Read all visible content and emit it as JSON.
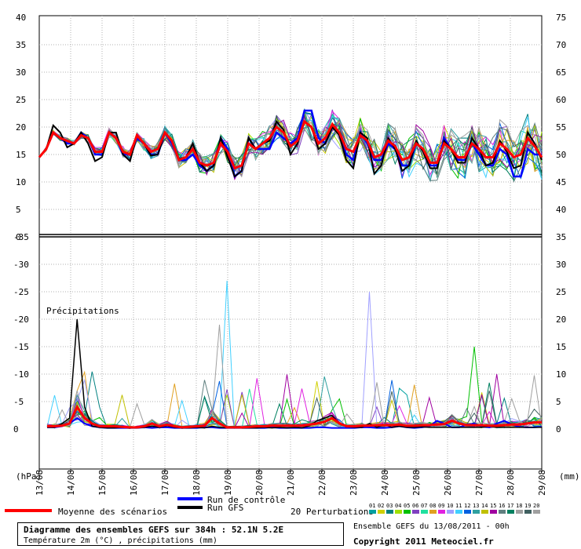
{
  "chart_data": {
    "type": "line",
    "top_panel": {
      "y_left_ticks": [
        40,
        35,
        30,
        25,
        20,
        15,
        10,
        5,
        0
      ],
      "y_right_ticks": [
        75,
        70,
        65,
        60,
        55,
        50,
        45,
        40,
        35
      ],
      "ylim": [
        0,
        40
      ]
    },
    "bottom_panel": {
      "title": "Précipitations",
      "y_left_ticks": [
        0,
        -5,
        -10,
        -15,
        -20,
        -25,
        -30,
        -35
      ],
      "y_right_ticks": [
        35,
        30,
        25,
        20,
        15,
        10,
        5,
        0
      ],
      "ylim": [
        0,
        35
      ]
    },
    "x_dates": [
      "13/08",
      "14/08",
      "15/08",
      "16/08",
      "17/08",
      "18/08",
      "19/08",
      "20/08",
      "21/08",
      "22/08",
      "23/08",
      "24/08",
      "25/08",
      "26/08",
      "27/08",
      "28/08",
      "29/08"
    ],
    "x_left_unit": "(hPa)",
    "x_right_unit": "(mm)",
    "temp_mean": [
      14.5,
      16,
      19,
      18,
      17.5,
      17,
      18.5,
      18,
      15.5,
      15.5,
      19,
      18,
      15.5,
      15,
      18.5,
      17,
      15.5,
      16,
      19,
      17.5,
      14,
      14.5,
      16,
      13.5,
      13,
      13.5,
      17,
      15.5,
      12.5,
      13,
      17,
      16,
      17,
      18,
      20,
      19,
      16.5,
      17.5,
      21,
      20,
      17,
      18,
      20.5,
      19,
      16,
      15.5,
      18.5,
      17.5,
      14.5,
      15,
      17.5,
      16.5,
      14,
      14.5,
      17,
      16,
      13.5,
      13.5,
      17,
      16,
      14.5,
      14.5,
      17,
      16,
      14.5,
      14.5,
      17,
      16,
      14.5,
      15,
      18,
      16.5,
      14.5
    ],
    "temp_gfs": [
      14.5,
      16,
      20.3,
      19,
      16.3,
      17,
      19,
      17,
      13.8,
      14.5,
      19,
      19,
      15,
      13.8,
      18.5,
      17,
      14.8,
      15,
      19,
      17.5,
      14.2,
      14.5,
      17,
      13.5,
      12,
      13,
      18,
      14.5,
      11,
      12,
      18,
      16,
      17,
      17.5,
      21,
      19.5,
      15,
      17,
      21,
      20,
      16,
      17,
      20,
      18.5,
      14,
      12.5,
      19,
      18,
      11.5,
      13,
      18,
      16,
      12,
      13,
      17.5,
      15.5,
      12.5,
      12.5,
      17.5,
      16,
      13.5,
      13.5,
      18,
      16,
      13,
      13.5,
      17.5,
      15.5,
      12.5,
      13,
      19,
      17,
      14
    ],
    "temp_control": [
      14.5,
      16,
      19,
      18,
      17,
      17,
      19,
      18,
      15,
      15,
      19,
      18,
      15,
      15,
      18,
      17,
      15,
      15,
      19,
      17,
      14,
      14,
      15,
      13,
      12,
      13,
      18,
      16,
      11,
      12,
      18,
      16,
      16,
      16,
      19,
      18,
      17,
      18,
      23,
      23,
      18,
      17,
      20,
      19,
      15,
      14,
      19,
      17,
      14,
      14,
      17,
      16,
      13,
      13,
      17,
      16,
      13,
      13,
      18,
      16,
      14,
      14,
      17,
      15,
      13,
      13,
      16,
      15,
      11,
      11,
      16,
      15,
      15
    ],
    "precip_mean": [
      0.5,
      0.5,
      0.6,
      1,
      4,
      2,
      1,
      0.5,
      0.5,
      0.5,
      0.4,
      0.3,
      0.3,
      0.5,
      1,
      0.5,
      0.8,
      0.5,
      0.3,
      0.4,
      0.5,
      0.6,
      2,
      1,
      0.3,
      0.3,
      0.3,
      0.4,
      0.5,
      0.5,
      0.6,
      0.6,
      0.6,
      0.6,
      0.6,
      0.8,
      1,
      1.3,
      2,
      1,
      0.5,
      0.5,
      0.6,
      0.6,
      0.7,
      0.7,
      0.7,
      0.8,
      0.6,
      0.6,
      0.7,
      0.7,
      0.8,
      0.9,
      1.5,
      1,
      0.7,
      0.7,
      0.7,
      0.6,
      0.6,
      0.7,
      0.8,
      0.8,
      1,
      1.2,
      1.2
    ],
    "precip_gfs": [
      0.3,
      0.3,
      1,
      2,
      20,
      4,
      0.5,
      0.3,
      0.2,
      0.2,
      0.3,
      0.2,
      0.2,
      0.3,
      0.5,
      0.3,
      0.6,
      0.3,
      0.2,
      0.2,
      0.3,
      0.2,
      0.5,
      0.3,
      0.2,
      0.2,
      0.2,
      0.2,
      0.2,
      0.3,
      0.2,
      0.3,
      0.2,
      0.3,
      0.2,
      0.6,
      1.5,
      2,
      2.5,
      1,
      0.4,
      0.3,
      0.3,
      1,
      0.3,
      0.8,
      0.3,
      0.5,
      0.3,
      0.3,
      0.4,
      0.3,
      0.3,
      0.3,
      0.3,
      0.3,
      0.3,
      0.3,
      0.3,
      0.5,
      0.3,
      0.3,
      0.3,
      0.3,
      0.3,
      0.3,
      0.3
    ],
    "precip_control": [
      0.3,
      0.3,
      0.5,
      1,
      2,
      1,
      0.5,
      0.3,
      0.2,
      0.2,
      0.2,
      0.2,
      0.2,
      0.3,
      0.2,
      0.3,
      0.3,
      0.2,
      0.2,
      0.2,
      0.2,
      0.3,
      0.3,
      0.2,
      0.2,
      0.2,
      0.2,
      0.2,
      0.2,
      0.2,
      0.3,
      0.2,
      0.2,
      0.2,
      0.2,
      0.2,
      0.3,
      0.3,
      0.2,
      0.2,
      0.2,
      0.2,
      0.3,
      0.3,
      0.2,
      0.2,
      0.3,
      0.5,
      0.3,
      0.2,
      0.3,
      0.5,
      1.5,
      1,
      0.3,
      0.3,
      0.8,
      1,
      0.4,
      0.3,
      1,
      1.5,
      0.8,
      0.4,
      0.3,
      0.3,
      0.4
    ],
    "ensemble_colors": [
      "#00a0a0",
      "#d0d000",
      "#008080",
      "#a0e000",
      "#00c000",
      "#8040c0",
      "#20e0a0",
      "#e0a020",
      "#e020e0",
      "#a0a0ff",
      "#40d0ff",
      "#0060e0",
      "#30a0a0",
      "#c0c000",
      "#a000a0",
      "#608080",
      "#008060",
      "#a0a0a0",
      "#406060",
      "#a0a0a0"
    ],
    "legend": {
      "mean": "Moyenne des scénarios",
      "control": "Run de contrôle",
      "gfs": "Run GFS",
      "perturbations": "20 Perturbations",
      "perturbation_ids": [
        "01",
        "02",
        "03",
        "04",
        "05",
        "06",
        "07",
        "08",
        "09",
        "10",
        "11",
        "12",
        "13",
        "14",
        "15",
        "16",
        "17",
        "18",
        "19",
        "20"
      ]
    },
    "colors": {
      "mean": "#ff0000",
      "control": "#0000ff",
      "gfs": "#000000"
    }
  },
  "footer": {
    "title": "Diagramme des ensembles GEFS sur 384h : 52.1N 5.2E",
    "subtitle": "Température 2m (°C) , précipitations (mm)",
    "run": "Ensemble GEFS du 13/08/2011 - 00h",
    "copyright": "Copyright 2011 Meteociel.fr"
  }
}
